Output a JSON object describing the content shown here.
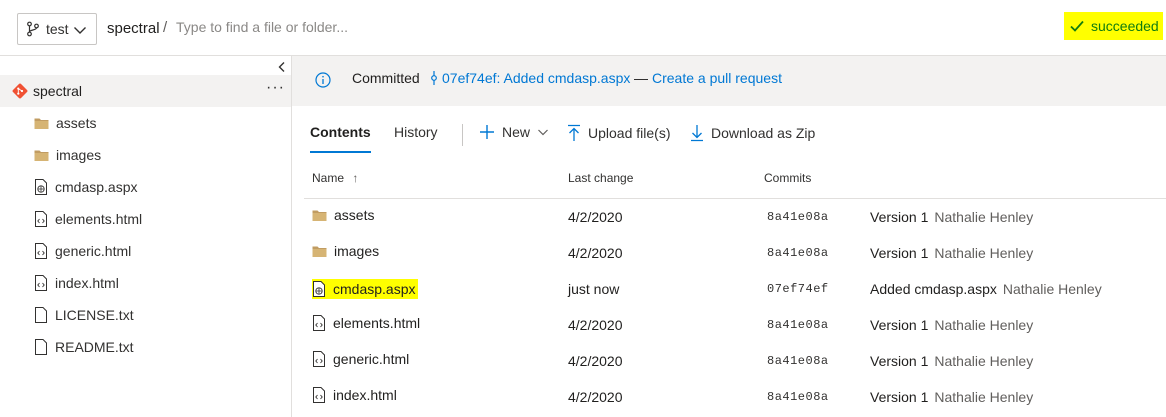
{
  "topbar": {
    "branch": "test",
    "path_root": "spectral",
    "path_separator": "/",
    "path_placeholder": "Type to find a file or folder...",
    "status": "succeeded"
  },
  "tree": {
    "repo": "spectral",
    "more": "···",
    "items": [
      {
        "label": "assets",
        "icon": "folder-icon"
      },
      {
        "label": "images",
        "icon": "folder-icon"
      },
      {
        "label": "cmdasp.aspx",
        "icon": "web-file-icon"
      },
      {
        "label": "elements.html",
        "icon": "code-file-icon"
      },
      {
        "label": "generic.html",
        "icon": "code-file-icon"
      },
      {
        "label": "index.html",
        "icon": "code-file-icon"
      },
      {
        "label": "LICENSE.txt",
        "icon": "file-icon"
      },
      {
        "label": "README.txt",
        "icon": "file-icon"
      }
    ]
  },
  "banner": {
    "prefix": "Committed",
    "commit_link": "07ef74ef: Added cmdasp.aspx",
    "dash": "—",
    "pr_link": "Create a pull request"
  },
  "tabs": {
    "contents": "Contents",
    "history": "History"
  },
  "toolbar": {
    "new": "New",
    "upload": "Upload file(s)",
    "download": "Download as Zip"
  },
  "table": {
    "columns": {
      "name": "Name",
      "sort_indicator": "↑",
      "last_change": "Last change",
      "commits": "Commits"
    },
    "rows": [
      {
        "name": "assets",
        "icon": "folder-icon",
        "date": "4/2/2020",
        "hash": "8a41e08a",
        "message": "Version 1",
        "author": "Nathalie Henley",
        "highlight": false
      },
      {
        "name": "images",
        "icon": "folder-icon",
        "date": "4/2/2020",
        "hash": "8a41e08a",
        "message": "Version 1",
        "author": "Nathalie Henley",
        "highlight": false
      },
      {
        "name": "cmdasp.aspx",
        "icon": "web-file-icon",
        "date": "just now",
        "hash": "07ef74ef",
        "message": "Added cmdasp.aspx",
        "author": "Nathalie Henley",
        "highlight": true
      },
      {
        "name": "elements.html",
        "icon": "code-file-icon",
        "date": "4/2/2020",
        "hash": "8a41e08a",
        "message": "Version 1",
        "author": "Nathalie Henley",
        "highlight": false
      },
      {
        "name": "generic.html",
        "icon": "code-file-icon",
        "date": "4/2/2020",
        "hash": "8a41e08a",
        "message": "Version 1",
        "author": "Nathalie Henley",
        "highlight": false
      },
      {
        "name": "index.html",
        "icon": "code-file-icon",
        "date": "4/2/2020",
        "hash": "8a41e08a",
        "message": "Version 1",
        "author": "Nathalie Henley",
        "highlight": false
      }
    ]
  },
  "colors": {
    "accent": "#0078d4",
    "success": "#107c10",
    "highlight": "#ffff00",
    "git": "#f05133"
  }
}
